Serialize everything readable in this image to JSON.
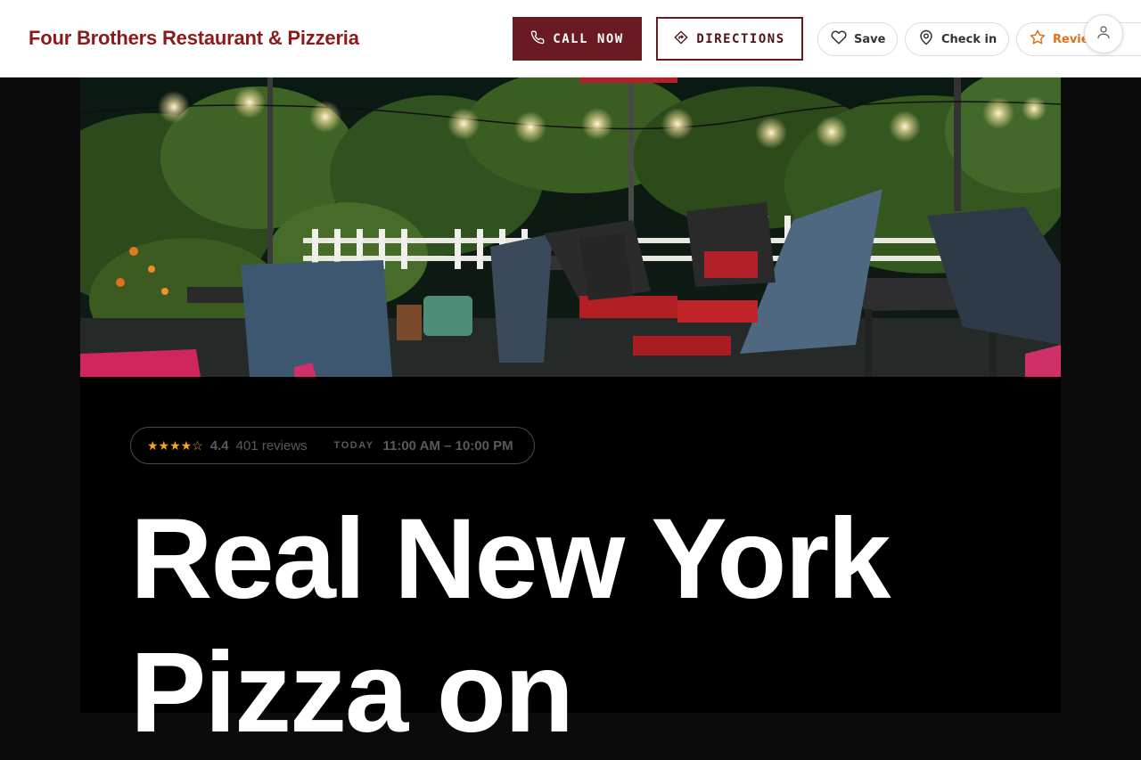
{
  "header": {
    "brand": "Four Brothers Restaurant & Pizzeria",
    "call_label": "CALL NOW",
    "directions_label": "DIRECTIONS",
    "save_label": "Save",
    "checkin_label": "Check in",
    "review_label": "Review"
  },
  "meta": {
    "stars": "★★★★☆",
    "rating": "4.4",
    "reviews": "401 reviews",
    "today_label": "TODAY",
    "hours": "11:00 AM – 10:00 PM"
  },
  "hero": {
    "headline_line1": "Real New York",
    "headline_line2": "Pizza on"
  },
  "colors": {
    "brand": "#8b1a1a",
    "primary_button": "#6b1a22",
    "star": "#f5a623",
    "review_accent": "#e0701a"
  },
  "icons": {
    "call": "phone-icon",
    "directions": "directions-icon",
    "save": "heart-icon",
    "checkin": "map-pin-icon",
    "review": "star-icon",
    "account": "user-icon"
  }
}
